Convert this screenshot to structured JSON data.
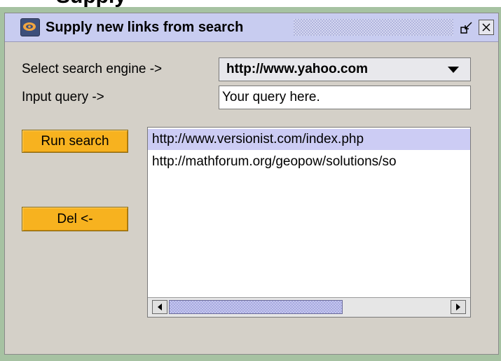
{
  "background_title": "Supply",
  "window": {
    "title": "Supply new links from search",
    "title_icon": "app-logo-icon",
    "minimize_icon": "minimize-icon",
    "close_icon": "close-icon"
  },
  "form": {
    "engine_label": "Select search engine ->",
    "engine_value": "http://www.yahoo.com",
    "query_label": "Input query ->",
    "query_value": "Your query here."
  },
  "buttons": {
    "run_search": "Run search",
    "delete": "Del <-"
  },
  "results": {
    "items": [
      {
        "label": "http://www.versionist.com/index.php",
        "selected": true
      },
      {
        "label": "http://mathforum.org/geopow/solutions/so",
        "selected": false
      }
    ],
    "scrollbar": {
      "left_icon": "arrow-left-icon",
      "right_icon": "arrow-right-icon"
    }
  },
  "colors": {
    "title_bar": "#c8ccf0",
    "button_accent": "#f7b21f",
    "selection": "#ccccf4",
    "panel": "#d4d0c8"
  }
}
